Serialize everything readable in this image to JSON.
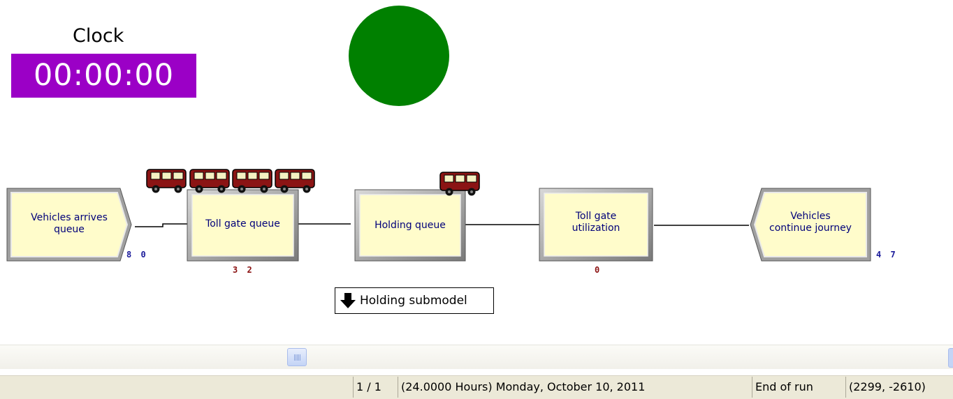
{
  "clock": {
    "label": "Clock",
    "time": "00:00:00",
    "background_color": "#9b00c6"
  },
  "signal": {
    "color": "#008000"
  },
  "modules": {
    "create": {
      "label_line1": "Vehicles arrives",
      "label_line2": "queue",
      "count": "8 0"
    },
    "toll_gate_queue": {
      "label": "Toll gate queue",
      "count": "3 2"
    },
    "holding_queue": {
      "label": "Holding queue"
    },
    "toll_gate_utilization": {
      "label_line1": "Toll gate",
      "label_line2": "utilization",
      "count": "0"
    },
    "dispose": {
      "label_line1": "Vehicles",
      "label_line2": "continue journey",
      "count": "4 7"
    }
  },
  "entities": {
    "queued_vehicle_count": 4,
    "holding_vehicle_count": 1,
    "vehicle_icon": "van-icon",
    "vehicle_color": "#8b1414"
  },
  "submodel": {
    "label": "Holding submodel",
    "icon": "down-arrow-icon"
  },
  "statusbar": {
    "replication": "1 / 1",
    "sim_time": "(24.0000 Hours) Monday, October 10, 2011",
    "run_state": "End of run",
    "coordinates": "(2299, -2610)"
  }
}
